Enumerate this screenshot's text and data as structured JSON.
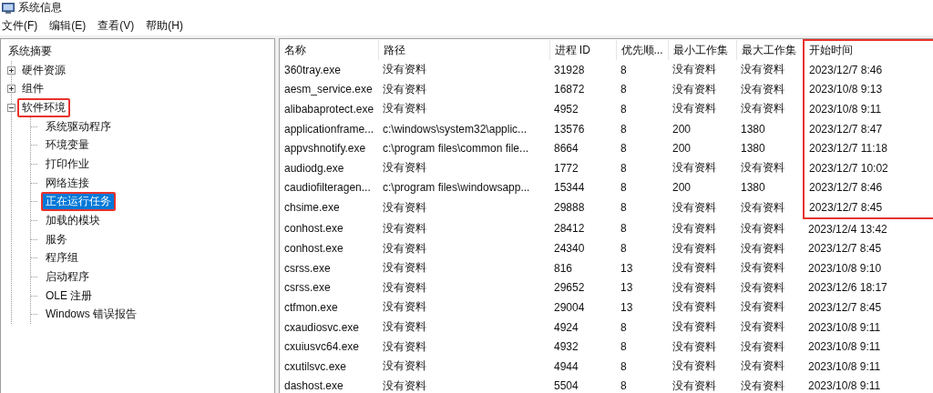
{
  "window": {
    "title": "系统信息"
  },
  "menu": [
    "文件(F)",
    "编辑(E)",
    "查看(V)",
    "帮助(H)"
  ],
  "tree": [
    {
      "label": "系统摘要",
      "selected": false,
      "highlighted": false,
      "children": [
        {
          "label": "硬件资源",
          "expanded": false,
          "selected": false,
          "highlighted": false
        },
        {
          "label": "组件",
          "expanded": false,
          "selected": false,
          "highlighted": false
        },
        {
          "label": "软件环境",
          "expanded": true,
          "selected": false,
          "highlighted": true,
          "children": [
            {
              "label": "系统驱动程序",
              "selected": false,
              "highlighted": false
            },
            {
              "label": "环境变量",
              "selected": false,
              "highlighted": false
            },
            {
              "label": "打印作业",
              "selected": false,
              "highlighted": false
            },
            {
              "label": "网络连接",
              "selected": false,
              "highlighted": false
            },
            {
              "label": "正在运行任务",
              "selected": true,
              "highlighted": true
            },
            {
              "label": "加载的模块",
              "selected": false,
              "highlighted": false
            },
            {
              "label": "服务",
              "selected": false,
              "highlighted": false
            },
            {
              "label": "程序组",
              "selected": false,
              "highlighted": false
            },
            {
              "label": "启动程序",
              "selected": false,
              "highlighted": false
            },
            {
              "label": "OLE 注册",
              "selected": false,
              "highlighted": false
            },
            {
              "label": "Windows 错误报告",
              "selected": false,
              "highlighted": false
            }
          ]
        }
      ]
    }
  ],
  "table": {
    "columns": [
      {
        "label": "名称",
        "highlighted": false
      },
      {
        "label": "路径",
        "highlighted": false
      },
      {
        "label": "进程 ID",
        "highlighted": false
      },
      {
        "label": "优先顺...",
        "highlighted": false
      },
      {
        "label": "最小工作集",
        "highlighted": false
      },
      {
        "label": "最大工作集",
        "highlighted": false
      },
      {
        "label": "开始时间",
        "highlighted": true
      }
    ],
    "rows": [
      {
        "highlighted": true,
        "cells": [
          "360tray.exe",
          "没有资料",
          "31928",
          "8",
          "没有资料",
          "没有资料",
          "2023/12/7 8:46"
        ]
      },
      {
        "highlighted": true,
        "cells": [
          "aesm_service.exe",
          "没有资料",
          "16872",
          "8",
          "没有资料",
          "没有资料",
          "2023/10/8 9:13"
        ]
      },
      {
        "highlighted": true,
        "cells": [
          "alibabaprotect.exe",
          "没有资料",
          "4952",
          "8",
          "没有资料",
          "没有资料",
          "2023/10/8 9:11"
        ]
      },
      {
        "highlighted": true,
        "cells": [
          "applicationframe...",
          "c:\\windows\\system32\\applic...",
          "13576",
          "8",
          "200",
          "1380",
          "2023/12/7 8:47"
        ]
      },
      {
        "highlighted": true,
        "cells": [
          "appvshnotify.exe",
          "c:\\program files\\common file...",
          "8664",
          "8",
          "200",
          "1380",
          "2023/12/7 11:18"
        ]
      },
      {
        "highlighted": true,
        "cells": [
          "audiodg.exe",
          "没有资料",
          "1772",
          "8",
          "没有资料",
          "没有资料",
          "2023/12/7 10:02"
        ]
      },
      {
        "highlighted": true,
        "cells": [
          "caudiofilteragen...",
          "c:\\program files\\windowsapp...",
          "15344",
          "8",
          "200",
          "1380",
          "2023/12/7 8:46"
        ]
      },
      {
        "highlighted": true,
        "cells": [
          "chsime.exe",
          "没有资料",
          "29888",
          "8",
          "没有资料",
          "没有资料",
          "2023/12/7 8:45"
        ]
      },
      {
        "highlighted": false,
        "cells": [
          "conhost.exe",
          "没有资料",
          "28412",
          "8",
          "没有资料",
          "没有资料",
          "2023/12/4 13:42"
        ]
      },
      {
        "highlighted": false,
        "cells": [
          "conhost.exe",
          "没有资料",
          "24340",
          "8",
          "没有资料",
          "没有资料",
          "2023/12/7 8:45"
        ]
      },
      {
        "highlighted": false,
        "cells": [
          "csrss.exe",
          "没有资料",
          "816",
          "13",
          "没有资料",
          "没有资料",
          "2023/10/8 9:10"
        ]
      },
      {
        "highlighted": false,
        "cells": [
          "csrss.exe",
          "没有资料",
          "29652",
          "13",
          "没有资料",
          "没有资料",
          "2023/12/6 18:17"
        ]
      },
      {
        "highlighted": false,
        "cells": [
          "ctfmon.exe",
          "没有资料",
          "29004",
          "13",
          "没有资料",
          "没有资料",
          "2023/12/7 8:45"
        ]
      },
      {
        "highlighted": false,
        "cells": [
          "cxaudiosvc.exe",
          "没有资料",
          "4924",
          "8",
          "没有资料",
          "没有资料",
          "2023/10/8 9:11"
        ]
      },
      {
        "highlighted": false,
        "cells": [
          "cxuiusvc64.exe",
          "没有资料",
          "4932",
          "8",
          "没有资料",
          "没有资料",
          "2023/10/8 9:11"
        ]
      },
      {
        "highlighted": false,
        "cells": [
          "cxutilsvc.exe",
          "没有资料",
          "4944",
          "8",
          "没有资料",
          "没有资料",
          "2023/10/8 9:11"
        ]
      },
      {
        "highlighted": false,
        "cells": [
          "dashost.exe",
          "没有资料",
          "5504",
          "8",
          "没有资料",
          "没有资料",
          "2023/10/8 9:11"
        ]
      }
    ]
  }
}
